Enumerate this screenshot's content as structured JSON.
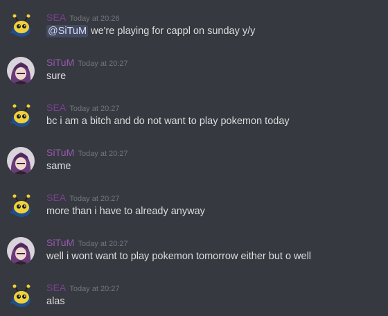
{
  "colors": {
    "background": "#36393f",
    "sea_name": "#7d3f96",
    "situm_name": "#9b59b6",
    "timestamp": "#72767d",
    "text": "#dcddde",
    "mention_bg": "#3b4266"
  },
  "messages": [
    {
      "author": "SEA",
      "avatar_icon": "yellow-pokemon-avatar",
      "timestamp": "Today at 20:26",
      "mention": "@SiTuM",
      "text": " we're playing for cappl on sunday y/y"
    },
    {
      "author": "SiTuM",
      "avatar_icon": "purple-hair-character-avatar",
      "timestamp": "Today at 20:27",
      "text": "sure"
    },
    {
      "author": "SEA",
      "avatar_icon": "yellow-pokemon-avatar",
      "timestamp": "Today at 20:27",
      "text": "bc i am a bitch and do not want to play pokemon today"
    },
    {
      "author": "SiTuM",
      "avatar_icon": "purple-hair-character-avatar",
      "timestamp": "Today at 20:27",
      "text": "same"
    },
    {
      "author": "SEA",
      "avatar_icon": "yellow-pokemon-avatar",
      "timestamp": "Today at 20:27",
      "text": "more than i have to already anyway"
    },
    {
      "author": "SiTuM",
      "avatar_icon": "purple-hair-character-avatar",
      "timestamp": "Today at 20:27",
      "text": "well i wont want to play pokemon tomorrow either but o well"
    },
    {
      "author": "SEA",
      "avatar_icon": "yellow-pokemon-avatar",
      "timestamp": "Today at 20:27",
      "text": "alas"
    }
  ]
}
